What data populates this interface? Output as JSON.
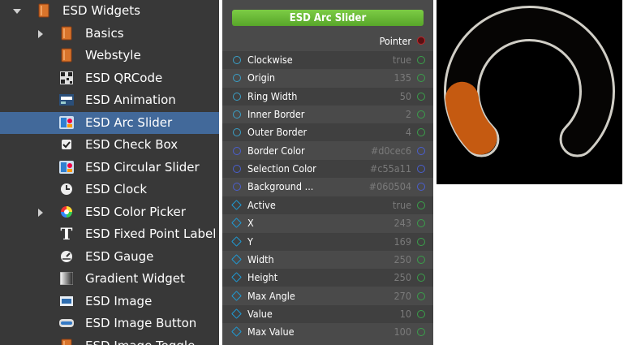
{
  "tree": {
    "items": [
      {
        "label": "ESD Widgets",
        "arrow": "down",
        "icon": "folder-icon",
        "level": 0
      },
      {
        "label": "Basics",
        "arrow": "right",
        "icon": "folder-icon",
        "level": 1
      },
      {
        "label": "Webstyle",
        "arrow": "",
        "icon": "folder-icon",
        "level": 1
      },
      {
        "label": "ESD QRCode",
        "arrow": "",
        "icon": "qrcode-icon",
        "level": 1
      },
      {
        "label": "ESD Animation",
        "arrow": "",
        "icon": "animation-icon",
        "level": 1
      },
      {
        "label": "ESD Arc Slider",
        "arrow": "",
        "icon": "image-widget-icon",
        "level": 1,
        "selected": true
      },
      {
        "label": "ESD Check Box",
        "arrow": "",
        "icon": "checkbox-icon",
        "level": 1
      },
      {
        "label": "ESD Circular Slider",
        "arrow": "",
        "icon": "image-widget-icon",
        "level": 1
      },
      {
        "label": "ESD Clock",
        "arrow": "",
        "icon": "clock-icon",
        "level": 1
      },
      {
        "label": "ESD Color Picker",
        "arrow": "right",
        "icon": "color-wheel-icon",
        "level": 1
      },
      {
        "label": "ESD Fixed Point Label",
        "arrow": "",
        "icon": "text-icon",
        "level": 1
      },
      {
        "label": "ESD Gauge",
        "arrow": "",
        "icon": "gauge-icon",
        "level": 1
      },
      {
        "label": "Gradient Widget",
        "arrow": "",
        "icon": "gradient-icon",
        "level": 1
      },
      {
        "label": "ESD Image",
        "arrow": "",
        "icon": "image-icon",
        "level": 1
      },
      {
        "label": "ESD Image Button",
        "arrow": "",
        "icon": "image-button-icon",
        "level": 1
      },
      {
        "label": "ESD Image Toggle",
        "arrow": "",
        "icon": "folder-icon",
        "level": 1
      }
    ]
  },
  "node": {
    "title": "ESD Arc Slider",
    "pointer_label": "Pointer",
    "properties": [
      {
        "label": "Clockwise",
        "value": "true",
        "port": "circle"
      },
      {
        "label": "Origin",
        "value": "135",
        "port": "circle"
      },
      {
        "label": "Ring Width",
        "value": "50",
        "port": "circle"
      },
      {
        "label": "Inner Border",
        "value": "2",
        "port": "circle"
      },
      {
        "label": "Outer Border",
        "value": "4",
        "port": "circle"
      },
      {
        "label": "Border Color",
        "value": "#d0cec6",
        "port": "circle"
      },
      {
        "label": "Selection Color",
        "value": "#c55a11",
        "port": "circle"
      },
      {
        "label": "Background ...",
        "value": "#060504",
        "port": "circle"
      },
      {
        "label": "Active",
        "value": "true",
        "port": "diamond"
      },
      {
        "label": "X",
        "value": "243",
        "port": "diamond"
      },
      {
        "label": "Y",
        "value": "169",
        "port": "diamond"
      },
      {
        "label": "Width",
        "value": "250",
        "port": "diamond"
      },
      {
        "label": "Height",
        "value": "250",
        "port": "diamond"
      },
      {
        "label": "Max Angle",
        "value": "270",
        "port": "diamond"
      },
      {
        "label": "Value",
        "value": "10",
        "port": "diamond"
      },
      {
        "label": "Max Value",
        "value": "100",
        "port": "diamond"
      }
    ]
  },
  "preview": {
    "origin": 135,
    "max_angle": 270,
    "value": 10,
    "max_value": 100,
    "border_color": "#d0cec6",
    "selection_color": "#c55a11",
    "background_color": "#060504"
  },
  "colors": {
    "port_circle": "#1e9bd6",
    "port_diamond": "#1e9bd6",
    "port_out": "#3aa04a",
    "pointer_port": "#c0262b"
  }
}
